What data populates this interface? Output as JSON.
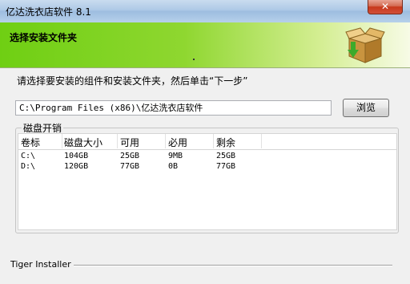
{
  "window": {
    "title": "亿达洗衣店软件 8.1",
    "close_label": "✕"
  },
  "banner": {
    "heading": "选择安装文件夹",
    "icon": "package-box-icon"
  },
  "instruction": "请选择要安装的组件和安装文件夹，然后单击“下一步”",
  "install_path": {
    "value": "C:\\Program Files (x86)\\亿达洗衣店软件"
  },
  "browse_label": "浏览",
  "disk_group": {
    "legend": "磁盘开销",
    "columns": [
      "卷标",
      "磁盘大小",
      "可用",
      "必用",
      "剩余"
    ],
    "rows": [
      [
        "C:\\",
        "104GB",
        "25GB",
        "9MB",
        "25GB"
      ],
      [
        "D:\\",
        "120GB",
        "77GB",
        "0B",
        "77GB"
      ]
    ]
  },
  "footer": {
    "label": "Tiger Installer"
  }
}
